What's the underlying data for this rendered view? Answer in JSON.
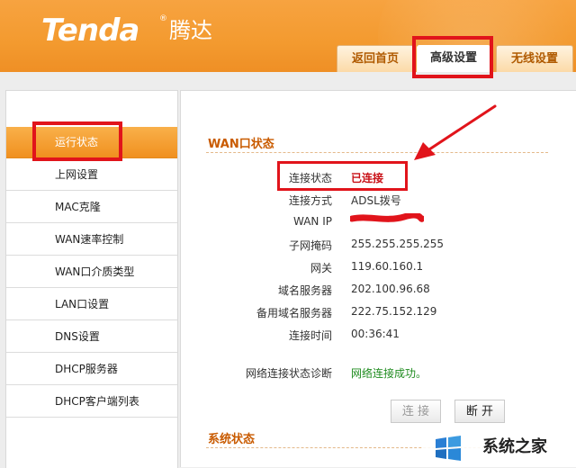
{
  "header": {
    "brand": "Tenda",
    "brand_reg": "®",
    "brand_cn": "腾达"
  },
  "tabs": {
    "home": "返回首页",
    "advanced": "高级设置",
    "wireless": "无线设置"
  },
  "sidebar": {
    "items": [
      {
        "label": "运行状态",
        "active": true
      },
      {
        "label": "上网设置"
      },
      {
        "label": "MAC克隆"
      },
      {
        "label": "WAN速率控制"
      },
      {
        "label": "WAN口介质类型"
      },
      {
        "label": "LAN口设置"
      },
      {
        "label": "DNS设置"
      },
      {
        "label": "DHCP服务器"
      },
      {
        "label": "DHCP客户端列表"
      }
    ]
  },
  "wan": {
    "title": "WAN口状态",
    "rows": [
      {
        "label": "连接状态",
        "value": "已连接"
      },
      {
        "label": "连接方式",
        "value": "ADSL拨号"
      },
      {
        "label": "WAN IP",
        "value": ""
      },
      {
        "label": "子网掩码",
        "value": "255.255.255.255"
      },
      {
        "label": "网关",
        "value": "119.60.160.1"
      },
      {
        "label": "域名服务器",
        "value": "202.100.96.68"
      },
      {
        "label": "备用域名服务器",
        "value": "222.75.152.129"
      },
      {
        "label": "连接时间",
        "value": "00:36:41"
      }
    ],
    "diag_label": "网络连接状态诊断",
    "diag_value": "网络连接成功。",
    "btn_connect": "连 接",
    "btn_disconnect": "断 开"
  },
  "system": {
    "title": "系统状态"
  },
  "watermark": {
    "text": "系统之家"
  },
  "colors": {
    "brand_orange": "#f39a2f",
    "highlight_red": "#e1141b",
    "status_green": "#1e8b1e"
  }
}
